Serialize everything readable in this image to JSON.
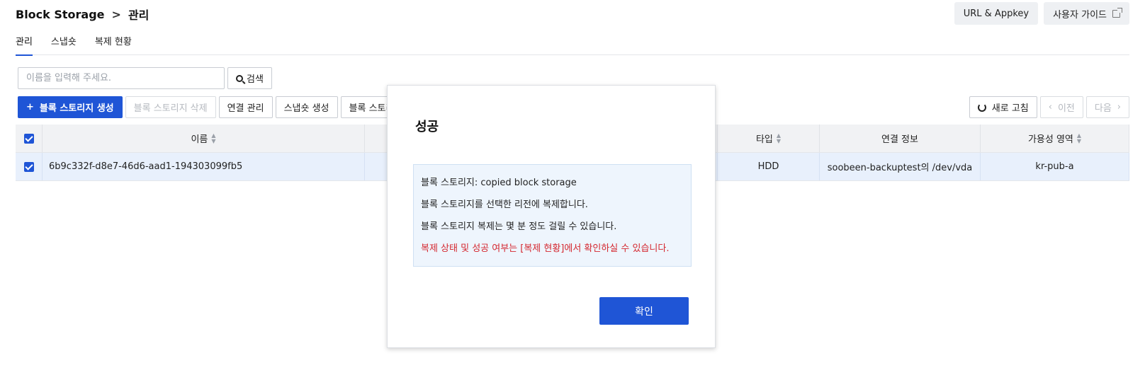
{
  "breadcrumb": {
    "service": "Block Storage",
    "separator": ">",
    "page": "관리"
  },
  "top_buttons": {
    "url_appkey": "URL & Appkey",
    "user_guide": "사용자 가이드"
  },
  "tabs": [
    {
      "label": "관리",
      "active": true
    },
    {
      "label": "스냅숏",
      "active": false
    },
    {
      "label": "복제 현황",
      "active": false
    }
  ],
  "search": {
    "placeholder": "이름을 입력해 주세요.",
    "button_label": "검색"
  },
  "actions": {
    "create": "블록 스토리지 생성",
    "delete": "블록 스토리지 삭제",
    "connect": "연결 관리",
    "snapshot": "스냅숏 생성",
    "more": "블록 스토리"
  },
  "right_actions": {
    "refresh": "새로 고침",
    "prev": "이전",
    "next": "다음"
  },
  "table": {
    "headers": {
      "name": "이름",
      "type": "타입",
      "connection": "연결 정보",
      "zone": "가용성 영역"
    },
    "rows": [
      {
        "name": "6b9c332f-d8e7-46d6-aad1-194303099fb5",
        "type": "HDD",
        "connection": "soobeen-backuptest의 /dev/vda",
        "zone": "kr-pub-a"
      }
    ]
  },
  "modal": {
    "title": "성공",
    "lines": [
      "블록 스토리지: copied block storage",
      "블록 스토리지를 선택한 리전에 복제합니다.",
      "블록 스토리지 복제는 몇 분 정도 걸릴 수 있습니다."
    ],
    "warning": "복제 상태 및 성공 여부는 [복제 현황]에서 확인하실 수 있습니다.",
    "confirm": "확인"
  },
  "colors": {
    "primary": "#1f55d6",
    "warning": "#d4272f",
    "selected_row": "#e8f0fc"
  }
}
